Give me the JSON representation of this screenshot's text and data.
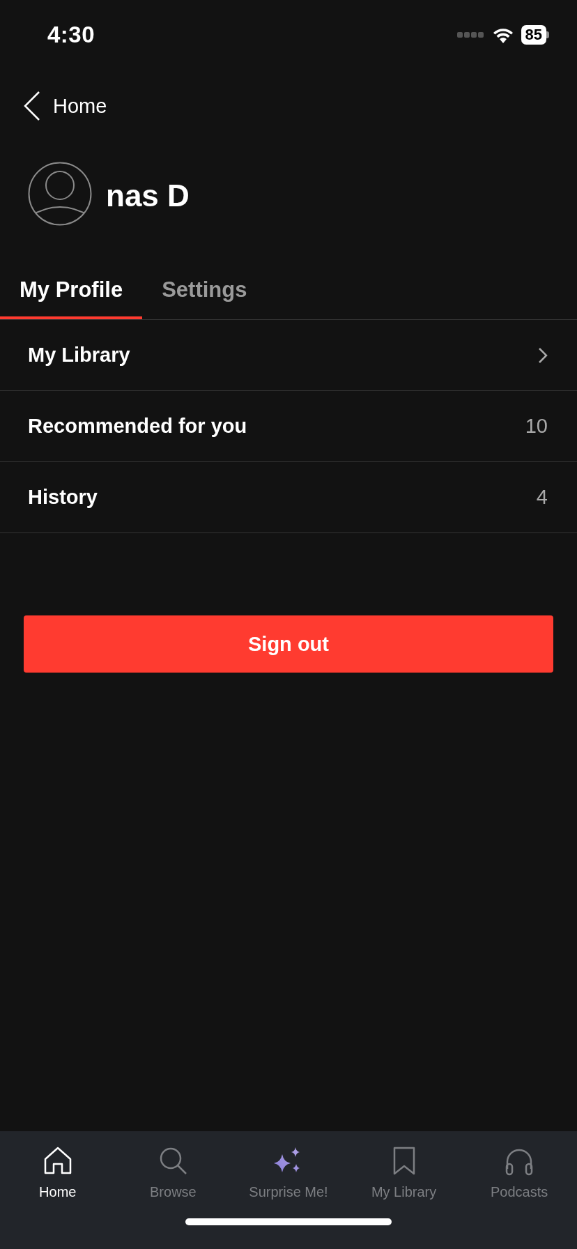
{
  "status_bar": {
    "time": "4:30",
    "battery": "85"
  },
  "nav": {
    "back_label": "Home"
  },
  "profile": {
    "name": "nas D"
  },
  "tabs": [
    {
      "label": "My Profile",
      "selected": true
    },
    {
      "label": "Settings",
      "selected": false
    }
  ],
  "menu": [
    {
      "label": "My Library",
      "kind": "link"
    },
    {
      "label": "Recommended for you",
      "kind": "count",
      "count": "10"
    },
    {
      "label": "History",
      "kind": "count",
      "count": "4"
    }
  ],
  "sign_out": {
    "label": "Sign out"
  },
  "bottom_nav": [
    {
      "label": "Home",
      "selected": true
    },
    {
      "label": "Browse",
      "selected": false
    },
    {
      "label": "Surprise Me!",
      "selected": false
    },
    {
      "label": "My Library",
      "selected": false
    },
    {
      "label": "Podcasts",
      "selected": false
    }
  ]
}
